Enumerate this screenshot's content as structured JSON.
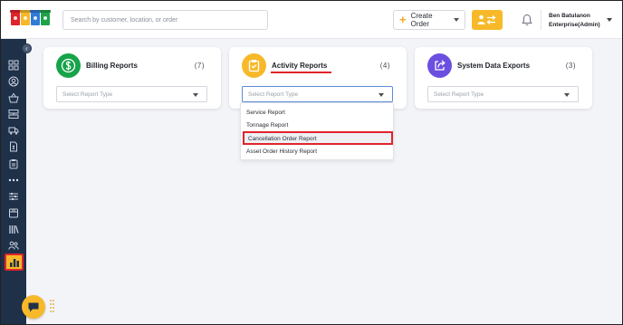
{
  "header": {
    "search_placeholder": "Search by customer, location, or order",
    "create_order_label": "Create Order",
    "user_name": "Ben Batulanon",
    "user_org": "Enterprise(Admin)"
  },
  "cards": [
    {
      "title": "Billing Reports",
      "count": "(7)",
      "select_placeholder": "Select Report Type",
      "icon": "dollar-icon",
      "color": "#17a34a"
    },
    {
      "title": "Activity Reports",
      "count": "(4)",
      "select_placeholder": "Select Report Type",
      "icon": "clipboard-icon",
      "color": "#f7b92a"
    },
    {
      "title": "System Data Exports",
      "count": "(3)",
      "select_placeholder": "Select Report Type",
      "icon": "share-icon",
      "color": "#6b4fe0"
    }
  ],
  "dropdown": {
    "options": [
      "Service Report",
      "Tonnage Report",
      "Cancellation Order Report",
      "Asset Order History Report"
    ],
    "highlighted_index": 2
  },
  "colors": {
    "sidebar": "#1f3049",
    "accent": "#f7b92a",
    "highlight": "#e0242c"
  }
}
